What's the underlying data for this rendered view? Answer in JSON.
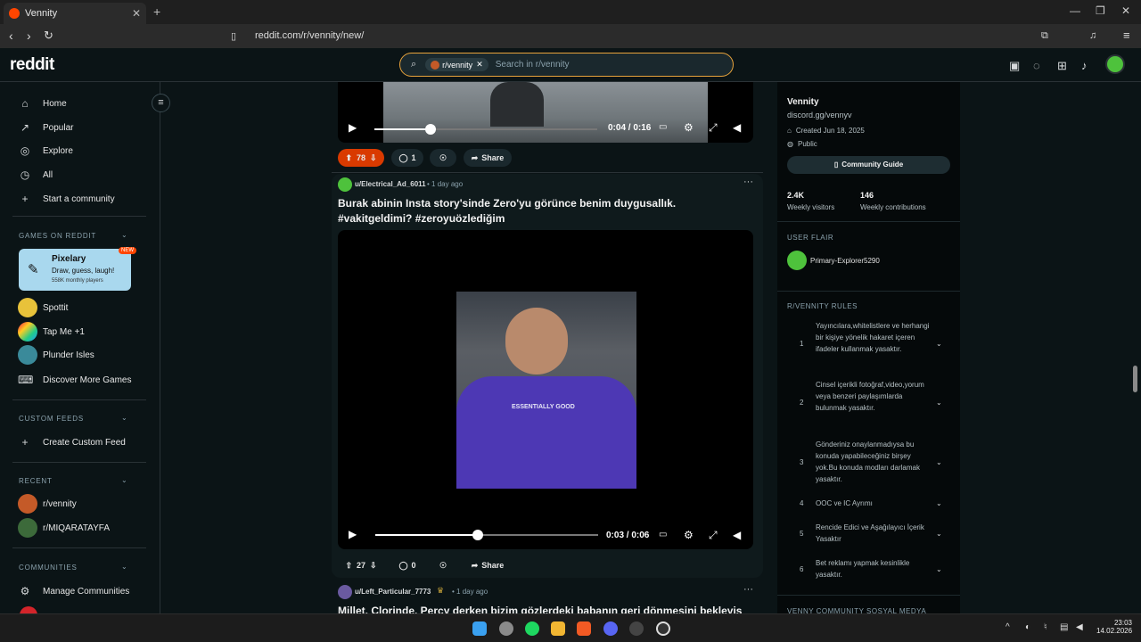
{
  "browser": {
    "tab_title": "Vennity",
    "url": "reddit.com/r/vennity/new/"
  },
  "header": {
    "logo": "reddit",
    "search_chip": "r/vennity",
    "search_placeholder": "Search in r/vennity"
  },
  "leftnav": {
    "items": [
      {
        "label": "Home",
        "icon": "home-icon"
      },
      {
        "label": "Popular",
        "icon": "popular-icon"
      },
      {
        "label": "Explore",
        "icon": "explore-icon"
      },
      {
        "label": "All",
        "icon": "all-icon"
      },
      {
        "label": "Start a community",
        "icon": "plus-icon"
      }
    ],
    "games_title": "GAMES ON REDDIT",
    "pixelary": {
      "title": "Pixelary",
      "desc": "Draw, guess, laugh!",
      "players": "558K monthly players",
      "badge": "NEW"
    },
    "games": [
      {
        "label": "Spottit"
      },
      {
        "label": "Tap Me +1"
      },
      {
        "label": "Plunder Isles"
      },
      {
        "label": "Discover More Games"
      }
    ],
    "custom_title": "CUSTOM FEEDS",
    "create_feed": "Create Custom Feed",
    "recent_title": "RECENT",
    "recent": [
      {
        "label": "r/vennity"
      },
      {
        "label": "r/MIQARATAYFA"
      }
    ],
    "communities_title": "COMMUNITIES",
    "manage": "Manage Communities"
  },
  "posts": [
    {
      "time_label": "0:04 / 0:16",
      "votes": "78",
      "comments": "1",
      "share": "Share",
      "progress": 0.25
    },
    {
      "author": "u/Electrical_Ad_6011",
      "age": "1 day ago",
      "title": "Burak abinin Insta story'sinde Zero'yu görünce benim duygusallık. #vakitgeldimi? #zeroyuözlediğim",
      "time_label": "0:03 / 0:06",
      "votes": "27",
      "comments": "0",
      "share": "Share",
      "progress": 0.46,
      "shirt_text": "ESSENTIALLY GOOD"
    },
    {
      "author": "u/Left_Particular_7773",
      "age": "1 day ago",
      "title": "Millet, Clorinde, Percy derken bizim gözlerdeki babanın geri dönmesini bekleyiş"
    }
  ],
  "sidebar": {
    "name": "Vennity",
    "link": "discord.gg/vennyv",
    "created": "Created Jun 18, 2025",
    "visibility": "Public",
    "guide": "Community Guide",
    "visitors": "2.4K",
    "visitors_label": "Weekly visitors",
    "contribs": "146",
    "contribs_label": "Weekly contributions",
    "flair_title": "USER FLAIR",
    "flair_user": "Primary-Explorer5290",
    "rules_title": "R/VENNITY RULES",
    "rules": [
      {
        "n": "1",
        "text": "Yayıncılara,whitelistlere ve herhangi bir kişiye yönelik hakaret içeren ifadeler kullanmak yasaktır."
      },
      {
        "n": "2",
        "text": "Cinsel içerikli fotoğraf,video,yorum veya benzeri paylaşımlarda bulunmak yasaktır."
      },
      {
        "n": "3",
        "text": "Gönderiniz onaylanmadıysa bu konuda yapabileceğiniz birşey yok.Bu konuda modları darlamak yasaktır."
      },
      {
        "n": "4",
        "text": "OOC ve IC Ayrımı"
      },
      {
        "n": "5",
        "text": "Rencide Edici ve Aşağılayıcı İçerik Yasaktır"
      },
      {
        "n": "6",
        "text": "Bet reklamı yapmak kesinlikle yasaktır."
      }
    ],
    "social_title": "VENNY COMMUNITY SOSYAL MEDYA"
  },
  "taskbar": {
    "time": "23:03",
    "date": "14.02.2026"
  },
  "colors": {
    "accent": "#ff4500",
    "bg": "#0b1416",
    "upvoted": "#d93a00"
  }
}
